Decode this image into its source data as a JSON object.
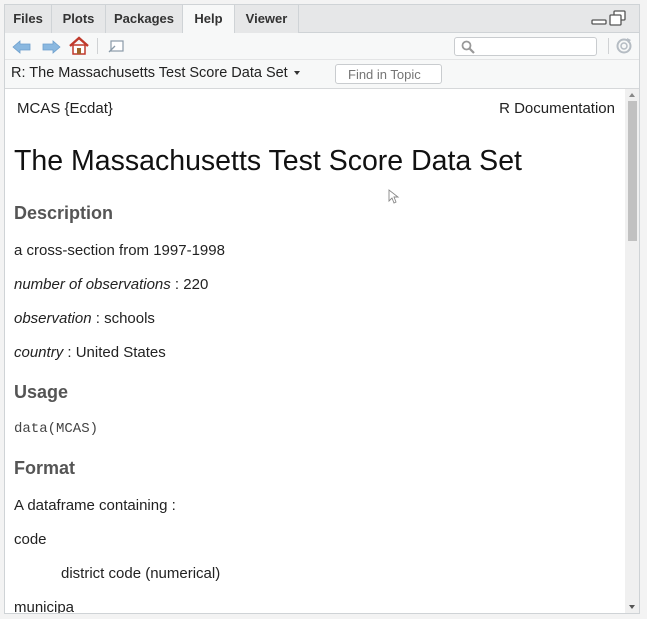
{
  "tabs": [
    {
      "label": "Files",
      "active": false
    },
    {
      "label": "Plots",
      "active": false
    },
    {
      "label": "Packages",
      "active": false
    },
    {
      "label": "Help",
      "active": true
    },
    {
      "label": "Viewer",
      "active": false
    }
  ],
  "toolbar": {
    "icons": [
      "back-arrow-icon",
      "forward-arrow-icon",
      "home-icon",
      "open-in-new-window-icon",
      "search-icon",
      "refresh-icon"
    ],
    "search_placeholder": ""
  },
  "topic_bar": {
    "title": "R: The Massachusetts Test Score Data Set",
    "find_placeholder": "Find in Topic"
  },
  "doc": {
    "header_left": "MCAS {Ecdat}",
    "header_right": "R Documentation",
    "title": "The Massachusetts Test Score Data Set",
    "description_heading": "Description",
    "description_text": "a cross-section from 1997-1998",
    "fields": [
      {
        "label": "number of observations",
        "value": " : 220"
      },
      {
        "label": "observation",
        "value": " : schools"
      },
      {
        "label": "country",
        "value": " : United States"
      }
    ],
    "usage_heading": "Usage",
    "usage_code": "data(MCAS)",
    "format_heading": "Format",
    "format_text": "A dataframe containing :",
    "variables": [
      {
        "name": "code",
        "desc": "district code (numerical)"
      },
      {
        "name": "municipa",
        "desc": ""
      }
    ]
  },
  "colors": {
    "home_icon": "#c0392b",
    "nav_arrows": "#8ab8e0",
    "heading_gray": "#555555"
  }
}
